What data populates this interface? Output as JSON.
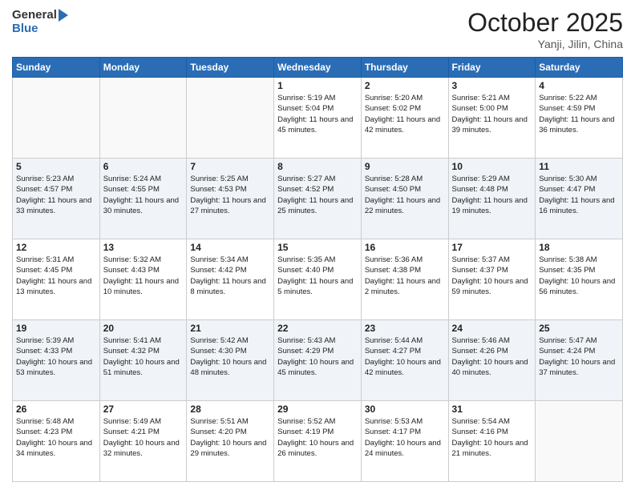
{
  "header": {
    "logo_general": "General",
    "logo_blue": "Blue",
    "month_title": "October 2025",
    "location": "Yanji, Jilin, China"
  },
  "days_of_week": [
    "Sunday",
    "Monday",
    "Tuesday",
    "Wednesday",
    "Thursday",
    "Friday",
    "Saturday"
  ],
  "weeks": [
    {
      "shaded": false,
      "days": [
        {
          "num": "",
          "sunrise": "",
          "sunset": "",
          "daylight": ""
        },
        {
          "num": "",
          "sunrise": "",
          "sunset": "",
          "daylight": ""
        },
        {
          "num": "",
          "sunrise": "",
          "sunset": "",
          "daylight": ""
        },
        {
          "num": "1",
          "sunrise": "Sunrise: 5:19 AM",
          "sunset": "Sunset: 5:04 PM",
          "daylight": "Daylight: 11 hours and 45 minutes."
        },
        {
          "num": "2",
          "sunrise": "Sunrise: 5:20 AM",
          "sunset": "Sunset: 5:02 PM",
          "daylight": "Daylight: 11 hours and 42 minutes."
        },
        {
          "num": "3",
          "sunrise": "Sunrise: 5:21 AM",
          "sunset": "Sunset: 5:00 PM",
          "daylight": "Daylight: 11 hours and 39 minutes."
        },
        {
          "num": "4",
          "sunrise": "Sunrise: 5:22 AM",
          "sunset": "Sunset: 4:59 PM",
          "daylight": "Daylight: 11 hours and 36 minutes."
        }
      ]
    },
    {
      "shaded": true,
      "days": [
        {
          "num": "5",
          "sunrise": "Sunrise: 5:23 AM",
          "sunset": "Sunset: 4:57 PM",
          "daylight": "Daylight: 11 hours and 33 minutes."
        },
        {
          "num": "6",
          "sunrise": "Sunrise: 5:24 AM",
          "sunset": "Sunset: 4:55 PM",
          "daylight": "Daylight: 11 hours and 30 minutes."
        },
        {
          "num": "7",
          "sunrise": "Sunrise: 5:25 AM",
          "sunset": "Sunset: 4:53 PM",
          "daylight": "Daylight: 11 hours and 27 minutes."
        },
        {
          "num": "8",
          "sunrise": "Sunrise: 5:27 AM",
          "sunset": "Sunset: 4:52 PM",
          "daylight": "Daylight: 11 hours and 25 minutes."
        },
        {
          "num": "9",
          "sunrise": "Sunrise: 5:28 AM",
          "sunset": "Sunset: 4:50 PM",
          "daylight": "Daylight: 11 hours and 22 minutes."
        },
        {
          "num": "10",
          "sunrise": "Sunrise: 5:29 AM",
          "sunset": "Sunset: 4:48 PM",
          "daylight": "Daylight: 11 hours and 19 minutes."
        },
        {
          "num": "11",
          "sunrise": "Sunrise: 5:30 AM",
          "sunset": "Sunset: 4:47 PM",
          "daylight": "Daylight: 11 hours and 16 minutes."
        }
      ]
    },
    {
      "shaded": false,
      "days": [
        {
          "num": "12",
          "sunrise": "Sunrise: 5:31 AM",
          "sunset": "Sunset: 4:45 PM",
          "daylight": "Daylight: 11 hours and 13 minutes."
        },
        {
          "num": "13",
          "sunrise": "Sunrise: 5:32 AM",
          "sunset": "Sunset: 4:43 PM",
          "daylight": "Daylight: 11 hours and 10 minutes."
        },
        {
          "num": "14",
          "sunrise": "Sunrise: 5:34 AM",
          "sunset": "Sunset: 4:42 PM",
          "daylight": "Daylight: 11 hours and 8 minutes."
        },
        {
          "num": "15",
          "sunrise": "Sunrise: 5:35 AM",
          "sunset": "Sunset: 4:40 PM",
          "daylight": "Daylight: 11 hours and 5 minutes."
        },
        {
          "num": "16",
          "sunrise": "Sunrise: 5:36 AM",
          "sunset": "Sunset: 4:38 PM",
          "daylight": "Daylight: 11 hours and 2 minutes."
        },
        {
          "num": "17",
          "sunrise": "Sunrise: 5:37 AM",
          "sunset": "Sunset: 4:37 PM",
          "daylight": "Daylight: 10 hours and 59 minutes."
        },
        {
          "num": "18",
          "sunrise": "Sunrise: 5:38 AM",
          "sunset": "Sunset: 4:35 PM",
          "daylight": "Daylight: 10 hours and 56 minutes."
        }
      ]
    },
    {
      "shaded": true,
      "days": [
        {
          "num": "19",
          "sunrise": "Sunrise: 5:39 AM",
          "sunset": "Sunset: 4:33 PM",
          "daylight": "Daylight: 10 hours and 53 minutes."
        },
        {
          "num": "20",
          "sunrise": "Sunrise: 5:41 AM",
          "sunset": "Sunset: 4:32 PM",
          "daylight": "Daylight: 10 hours and 51 minutes."
        },
        {
          "num": "21",
          "sunrise": "Sunrise: 5:42 AM",
          "sunset": "Sunset: 4:30 PM",
          "daylight": "Daylight: 10 hours and 48 minutes."
        },
        {
          "num": "22",
          "sunrise": "Sunrise: 5:43 AM",
          "sunset": "Sunset: 4:29 PM",
          "daylight": "Daylight: 10 hours and 45 minutes."
        },
        {
          "num": "23",
          "sunrise": "Sunrise: 5:44 AM",
          "sunset": "Sunset: 4:27 PM",
          "daylight": "Daylight: 10 hours and 42 minutes."
        },
        {
          "num": "24",
          "sunrise": "Sunrise: 5:46 AM",
          "sunset": "Sunset: 4:26 PM",
          "daylight": "Daylight: 10 hours and 40 minutes."
        },
        {
          "num": "25",
          "sunrise": "Sunrise: 5:47 AM",
          "sunset": "Sunset: 4:24 PM",
          "daylight": "Daylight: 10 hours and 37 minutes."
        }
      ]
    },
    {
      "shaded": false,
      "days": [
        {
          "num": "26",
          "sunrise": "Sunrise: 5:48 AM",
          "sunset": "Sunset: 4:23 PM",
          "daylight": "Daylight: 10 hours and 34 minutes."
        },
        {
          "num": "27",
          "sunrise": "Sunrise: 5:49 AM",
          "sunset": "Sunset: 4:21 PM",
          "daylight": "Daylight: 10 hours and 32 minutes."
        },
        {
          "num": "28",
          "sunrise": "Sunrise: 5:51 AM",
          "sunset": "Sunset: 4:20 PM",
          "daylight": "Daylight: 10 hours and 29 minutes."
        },
        {
          "num": "29",
          "sunrise": "Sunrise: 5:52 AM",
          "sunset": "Sunset: 4:19 PM",
          "daylight": "Daylight: 10 hours and 26 minutes."
        },
        {
          "num": "30",
          "sunrise": "Sunrise: 5:53 AM",
          "sunset": "Sunset: 4:17 PM",
          "daylight": "Daylight: 10 hours and 24 minutes."
        },
        {
          "num": "31",
          "sunrise": "Sunrise: 5:54 AM",
          "sunset": "Sunset: 4:16 PM",
          "daylight": "Daylight: 10 hours and 21 minutes."
        },
        {
          "num": "",
          "sunrise": "",
          "sunset": "",
          "daylight": ""
        }
      ]
    }
  ]
}
